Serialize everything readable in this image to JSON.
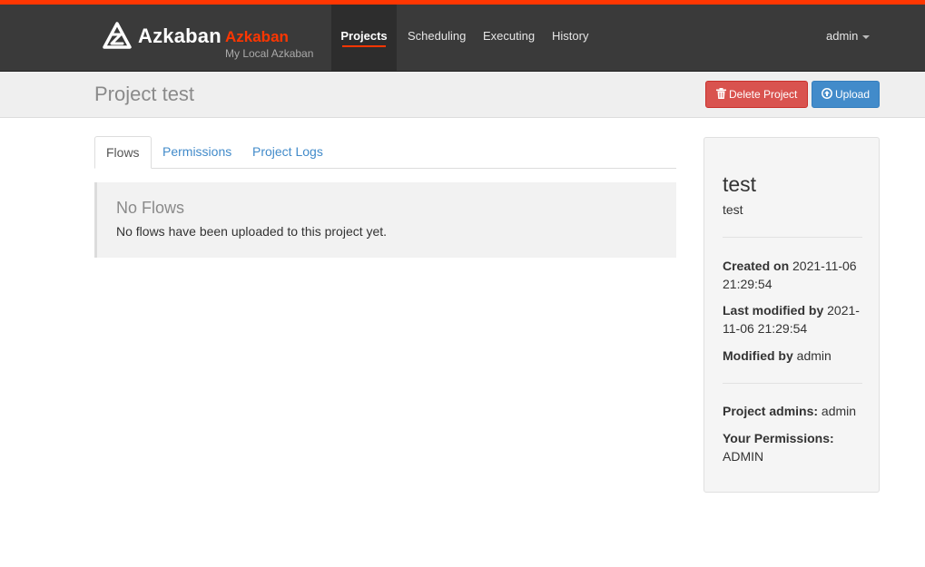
{
  "navbar": {
    "brand_name": "Azkaban",
    "env_name": "Azkaban",
    "env_subtitle": "My Local Azkaban",
    "items": [
      {
        "label": "Projects"
      },
      {
        "label": "Scheduling"
      },
      {
        "label": "Executing"
      },
      {
        "label": "History"
      }
    ],
    "user": "admin"
  },
  "header": {
    "title": "Project test",
    "delete_label": "Delete Project",
    "upload_label": "Upload"
  },
  "tabs": [
    {
      "label": "Flows"
    },
    {
      "label": "Permissions"
    },
    {
      "label": "Project Logs"
    }
  ],
  "empty_state": {
    "title": "No Flows",
    "text": "No flows have been uploaded to this project yet."
  },
  "sidebar": {
    "project_name": "test",
    "project_description": "test",
    "created_on_label": "Created on",
    "created_on_value": "2021-11-06 21:29:54",
    "last_modified_label": "Last modified by",
    "last_modified_value": "2021-11-06 21:29:54",
    "modified_by_label": "Modified by",
    "modified_by_value": "admin",
    "project_admins_label": "Project admins:",
    "project_admins_value": "admin",
    "your_permissions_label": "Your Permissions:",
    "your_permissions_value": "ADMIN"
  },
  "colors": {
    "accent": "#ff3601",
    "navbar_bg": "#3a3a3a",
    "danger": "#d9534f",
    "primary": "#428bca",
    "link": "#428bca"
  },
  "icons": {
    "brand": "azkaban-logo-icon",
    "delete": "trash-icon",
    "upload": "upload-circle-icon",
    "user_menu": "caret-down-icon"
  }
}
